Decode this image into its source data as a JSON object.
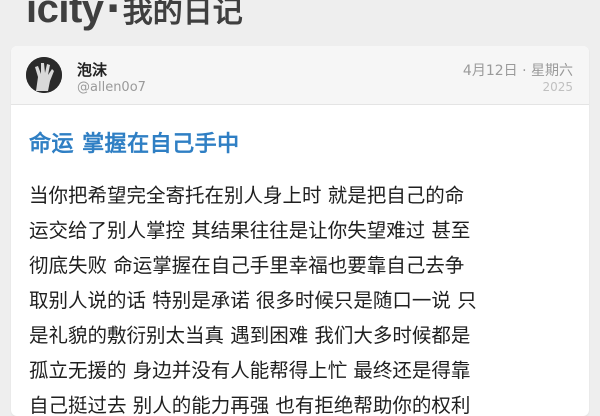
{
  "app": {
    "brand": "icity",
    "separator": "·",
    "subtitle": "我的日记"
  },
  "post": {
    "author_name": "泡沫",
    "author_handle": "@allen0o7",
    "date_label": "4月12日 · 星期六",
    "year": "2025",
    "title": "命运 掌握在自己手中",
    "body_lines": [
      "当你把希望完全寄托在别人身上时 就是把自己的命",
      "运交给了别人掌控 其结果往往是让你失望难过 甚至",
      "彻底失败 命运掌握在自己手里幸福也要靠自己去争",
      "取别人说的话 特别是承诺 很多时候只是随口一说 只",
      "是礼貌的敷衍别太当真 遇到困难 我们大多时候都是",
      "孤立无援的 身边并没有人能帮得上忙 最终还是得靠",
      "自己挺过去 别人的能力再强 也有拒绝帮助你的权利"
    ]
  }
}
